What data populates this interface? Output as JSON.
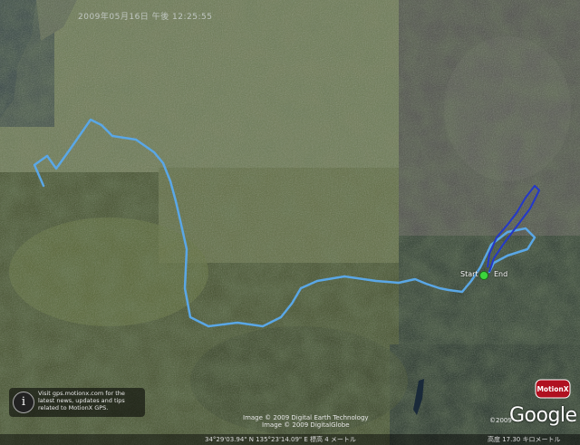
{
  "map": {
    "top_caption": "2009年05月16日 午後 12:25:55",
    "start_label": "Start",
    "end_label": "End",
    "promo_text": "Visit gps.motionx.com for the latest news, updates and tips related to MotionX GPS.",
    "credit_line1": "Image © 2009 Digital Earth Technology",
    "credit_line2": "Image © 2009 DigitalGlobe",
    "coordinates": "34°29'03.94\" N  135°23'14.09\" E  標高  4 メートル",
    "eye_altitude": "高度  17.30 キロメートル",
    "copyright": "©2009",
    "google_logo": "Google",
    "motionx_logo": "MotionX"
  },
  "colors": {
    "track_light": "#5aa7e6",
    "track_dark": "#2438c9",
    "marker": "#3cd63c"
  },
  "icons": {
    "promo_icon": "info-icon",
    "marker_icon": "start-end-marker"
  }
}
